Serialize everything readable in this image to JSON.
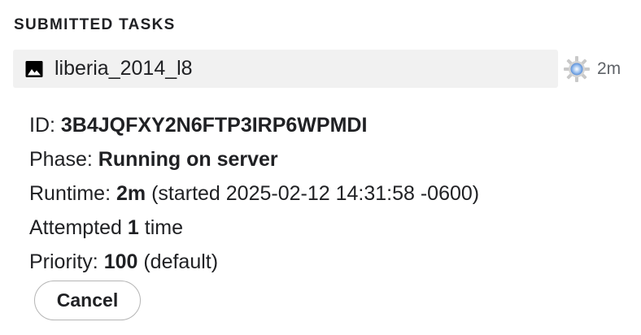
{
  "section": {
    "title": "SUBMITTED TASKS"
  },
  "task": {
    "icon": "image-icon",
    "name": "liberia_2014_l8",
    "status_icon": "spinner-gear-icon",
    "status_duration": "2m",
    "details": {
      "id_label": "ID: ",
      "id_value": "3B4JQFXY2N6FTP3IRP6WPMDI",
      "phase_label": "Phase: ",
      "phase_value": "Running on server",
      "runtime_label": "Runtime: ",
      "runtime_value": "2m",
      "runtime_suffix": " (started 2025-02-12 14:31:58 -0600)",
      "attempted_prefix": "Attempted ",
      "attempted_count": "1",
      "attempted_suffix": " time",
      "priority_label": "Priority: ",
      "priority_value": "100",
      "priority_suffix": " (default)"
    },
    "cancel_label": "Cancel"
  },
  "colors": {
    "row_background": "#f1f1f1",
    "text": "#202124",
    "muted_text": "#5f6368",
    "spinner_blue": "#6fa3e8"
  }
}
